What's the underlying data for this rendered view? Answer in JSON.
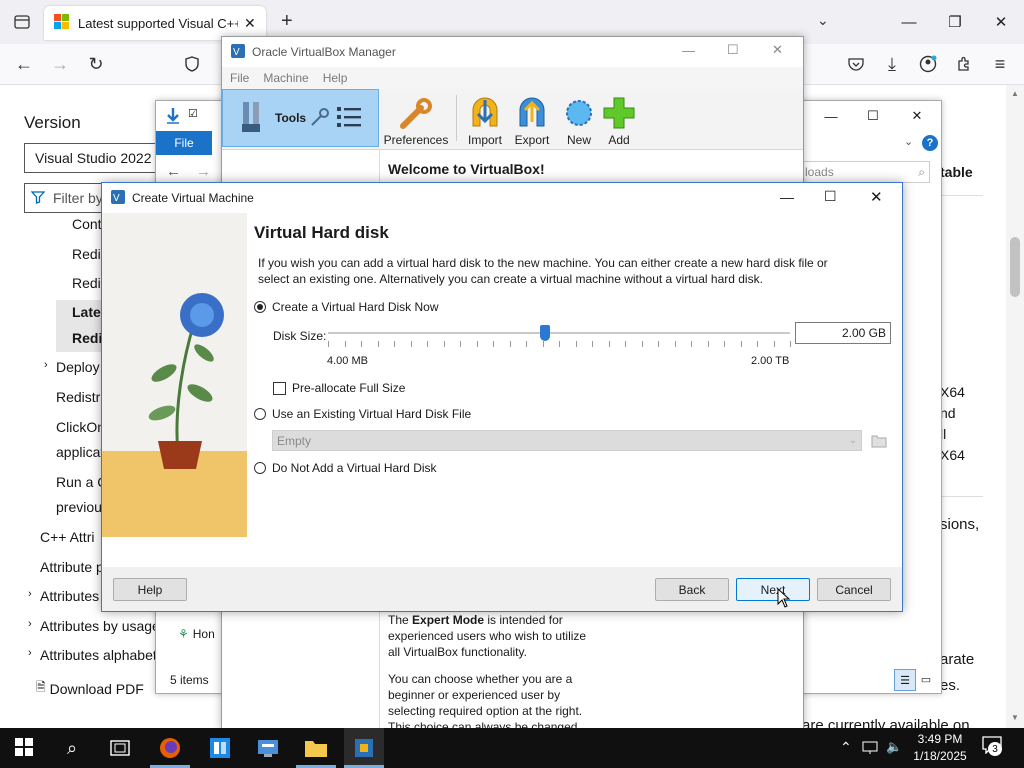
{
  "browser": {
    "tab_title": "Latest supported Visual C++ Re",
    "sidebar": {
      "version_label": "Version",
      "version_select": "Visual Studio 2022",
      "filter_placeholder": "Filter by",
      "items": [
        "Cont",
        "Redis",
        "Redis",
        "Lates",
        "Redi",
        "Deploy",
        "Redistri",
        "ClickOn",
        "applicat",
        "Run a C",
        "previou",
        "C++ Attri",
        "Attribute p",
        "Attributes",
        "Attributes by usage",
        "Attributes alphabet"
      ],
      "download_pdf": "Download PDF"
    },
    "right_fragments": [
      "table",
      "X64",
      "nd",
      "ll",
      "X64",
      "sions,",
      "arate",
      "es.",
      "are currently available on"
    ]
  },
  "explorer": {
    "ribbon_tab": "File",
    "search_placeholder": "loads",
    "status_items": "5 items",
    "tree_item": "Hon"
  },
  "vbox": {
    "title": "Oracle VirtualBox Manager",
    "menu": [
      "File",
      "Machine",
      "Help"
    ],
    "tools_label": "Tools",
    "toolbar": [
      "Preferences",
      "Import",
      "Export",
      "New",
      "Add"
    ],
    "welcome": "Welcome to VirtualBox!",
    "expert_text_prefix": "The ",
    "expert_bold": "Expert Mode",
    "expert_text_rest": " is intended for experienced users who wish to utilize all VirtualBox functionality.",
    "choose_text": "You can choose whether you are a beginner or experienced user by selecting required option at the right. This choice can always be changed in Global Preferences or Machine Settings windows."
  },
  "dialog": {
    "title": "Create Virtual Machine",
    "heading": "Virtual Hard disk",
    "description": "If you wish you can add a virtual hard disk to the new machine. You can either create a new hard disk file or select an existing one. Alternatively you can create a virtual machine without a virtual hard disk.",
    "option_create": "Create a Virtual Hard Disk Now",
    "disk_size_label": "Disk Size:",
    "disk_size_value": "2.00 GB",
    "slider_min": "4.00 MB",
    "slider_max": "2.00 TB",
    "slider_fraction": 0.47,
    "preallocate": "Pre-allocate Full Size",
    "option_existing": "Use an Existing Virtual Hard Disk File",
    "existing_value": "Empty",
    "option_none": "Do Not Add a Virtual Hard Disk",
    "buttons": {
      "help": "Help",
      "back": "Back",
      "next": "Next",
      "cancel": "Cancel"
    }
  },
  "taskbar": {
    "time": "3:49 PM",
    "date": "1/18/2025",
    "notification_count": "3"
  }
}
